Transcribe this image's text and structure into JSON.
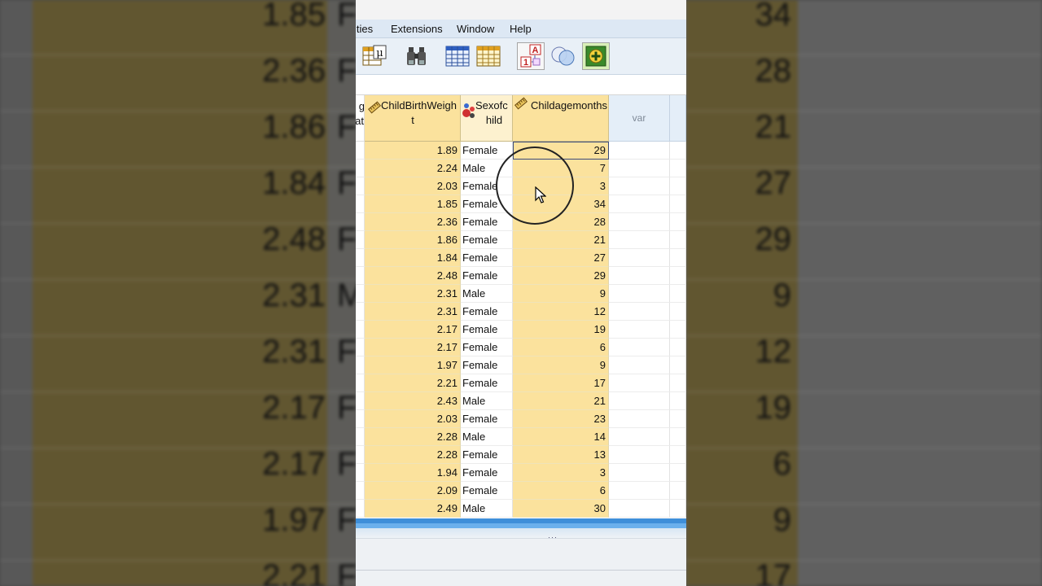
{
  "background_zoom": {
    "left_values": [
      "1.85",
      "2.36",
      "1.86",
      "1.84",
      "2.48",
      "2.31",
      "2.31",
      "2.17",
      "2.17",
      "1.97",
      "2.21"
    ],
    "left_letters": [
      "F",
      "F",
      "F",
      "F",
      "F",
      "M",
      "F",
      "F",
      "F",
      "F",
      "F"
    ],
    "right_values": [
      "34",
      "28",
      "21",
      "27",
      "29",
      "9",
      "12",
      "19",
      "6",
      "9",
      "17"
    ]
  },
  "menu": {
    "items": [
      "ities",
      "Extensions",
      "Window",
      "Help"
    ]
  },
  "toolbar": {
    "icons": [
      "variables-mu-icon",
      "find-binoculars-icon",
      "split-file-grid-icon",
      "select-cases-grid-icon",
      "value-labels-icon",
      "use-sets-circles-icon",
      "add-extension-icon"
    ]
  },
  "grid": {
    "partial_header_line1": "g",
    "partial_header_line2": "at",
    "columns": {
      "birthweight": {
        "line1": "ChildBirthWeigh",
        "line2": "t"
      },
      "sex": {
        "line1": "Sexofc",
        "line2": "hild"
      },
      "age": {
        "line1": "Childagemonths"
      },
      "var": {
        "label": "var"
      }
    },
    "rows": [
      {
        "weight": "1.89",
        "sex": "Female",
        "age": "29"
      },
      {
        "weight": "2.24",
        "sex": "Male",
        "age": "7"
      },
      {
        "weight": "2.03",
        "sex": "Female",
        "age": "3"
      },
      {
        "weight": "1.85",
        "sex": "Female",
        "age": "34"
      },
      {
        "weight": "2.36",
        "sex": "Female",
        "age": "28"
      },
      {
        "weight": "1.86",
        "sex": "Female",
        "age": "21"
      },
      {
        "weight": "1.84",
        "sex": "Female",
        "age": "27"
      },
      {
        "weight": "2.48",
        "sex": "Female",
        "age": "29"
      },
      {
        "weight": "2.31",
        "sex": "Male",
        "age": "9"
      },
      {
        "weight": "2.31",
        "sex": "Female",
        "age": "12"
      },
      {
        "weight": "2.17",
        "sex": "Female",
        "age": "19"
      },
      {
        "weight": "2.17",
        "sex": "Female",
        "age": "6"
      },
      {
        "weight": "1.97",
        "sex": "Female",
        "age": "9"
      },
      {
        "weight": "2.21",
        "sex": "Female",
        "age": "17"
      },
      {
        "weight": "2.43",
        "sex": "Male",
        "age": "21"
      },
      {
        "weight": "2.03",
        "sex": "Female",
        "age": "23"
      },
      {
        "weight": "2.28",
        "sex": "Male",
        "age": "14"
      },
      {
        "weight": "2.28",
        "sex": "Female",
        "age": "13"
      },
      {
        "weight": "1.94",
        "sex": "Female",
        "age": "3"
      },
      {
        "weight": "2.09",
        "sex": "Female",
        "age": "6"
      },
      {
        "weight": "2.49",
        "sex": "Male",
        "age": "30"
      }
    ]
  },
  "splitter": {
    "grip": "···"
  },
  "colors": {
    "variable_highlight": "#fbe29d",
    "menubar": "#dde8f4",
    "splitter": "#3f8fd9"
  }
}
